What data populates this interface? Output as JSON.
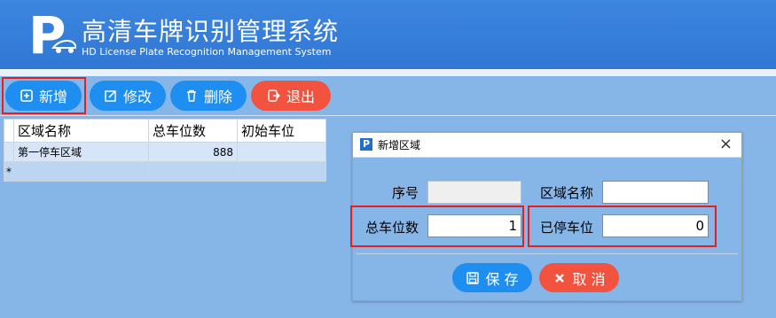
{
  "header": {
    "title_cn": "高清车牌识别管理系统",
    "title_en": "HD License Plate Recognition Management System",
    "logo_letter": "P"
  },
  "toolbar": {
    "add_label": "新增",
    "edit_label": "修改",
    "delete_label": "删除",
    "exit_label": "退出"
  },
  "grid": {
    "columns": [
      "区域名称",
      "总车位数",
      "初始车位"
    ],
    "rows": [
      {
        "marker": "",
        "name": "第一停车区域",
        "total": "888",
        "initial": ""
      },
      {
        "marker": "*",
        "name": "",
        "total": "",
        "initial": ""
      }
    ]
  },
  "dialog": {
    "title": "新增区域",
    "icon_letter": "P",
    "close": "×",
    "fields": {
      "seq_label": "序号",
      "seq_value": "",
      "area_label": "区域名称",
      "area_value": "",
      "total_label": "总车位数",
      "total_value": "1",
      "parked_label": "已停车位",
      "parked_value": "0"
    },
    "save_label": "保 存",
    "cancel_label": "取 消"
  },
  "colors": {
    "header_bg": "#2f77d3",
    "background": "#86b5e8",
    "button_blue": "#1e8ff0",
    "button_red": "#f2533e",
    "highlight_red": "#e31f1f"
  }
}
